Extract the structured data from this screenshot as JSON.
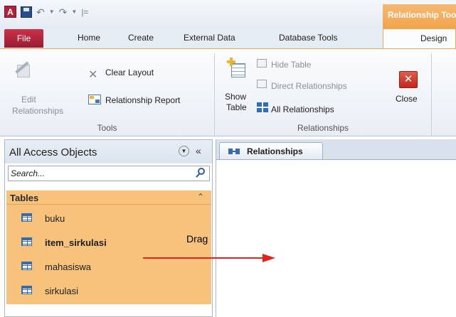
{
  "quick_access": {
    "qat_separator": "|="
  },
  "context_tab": {
    "label": "Relationship Tools"
  },
  "ribbon_tabs": {
    "file": "File",
    "home": "Home",
    "create": "Create",
    "external_data": "External Data",
    "database_tools": "Database Tools",
    "design": "Design"
  },
  "ribbon": {
    "tools_group": {
      "label": "Tools",
      "edit_relationships_line1": "Edit",
      "edit_relationships_line2": "Relationships",
      "clear_layout": "Clear Layout",
      "relationship_report": "Relationship Report"
    },
    "relationships_group": {
      "label": "Relationships",
      "show_table_line1": "Show",
      "show_table_line2": "Table",
      "hide_table": "Hide Table",
      "direct_relationships": "Direct Relationships",
      "all_relationships": "All Relationships",
      "close": "Close"
    }
  },
  "nav_pane": {
    "title": "All Access Objects",
    "search_placeholder": "Search...",
    "group_label": "Tables",
    "tables": [
      {
        "name": "buku"
      },
      {
        "name": "item_sirkulasi"
      },
      {
        "name": "mahasiswa"
      },
      {
        "name": "sirkulasi"
      }
    ]
  },
  "document": {
    "tab_label": "Relationships"
  },
  "annotation": {
    "drag_text": "Drag",
    "arrow_color": "#e3231b"
  },
  "colors": {
    "file_tab": "#b0213c",
    "context_tab": "#f2a44c",
    "nav_selection": "#f7c27b"
  },
  "icons": {
    "app": "access-app-icon",
    "save": "save-icon",
    "undo": "undo-icon",
    "redo": "redo-icon",
    "search": "search-icon",
    "table": "table-icon"
  }
}
